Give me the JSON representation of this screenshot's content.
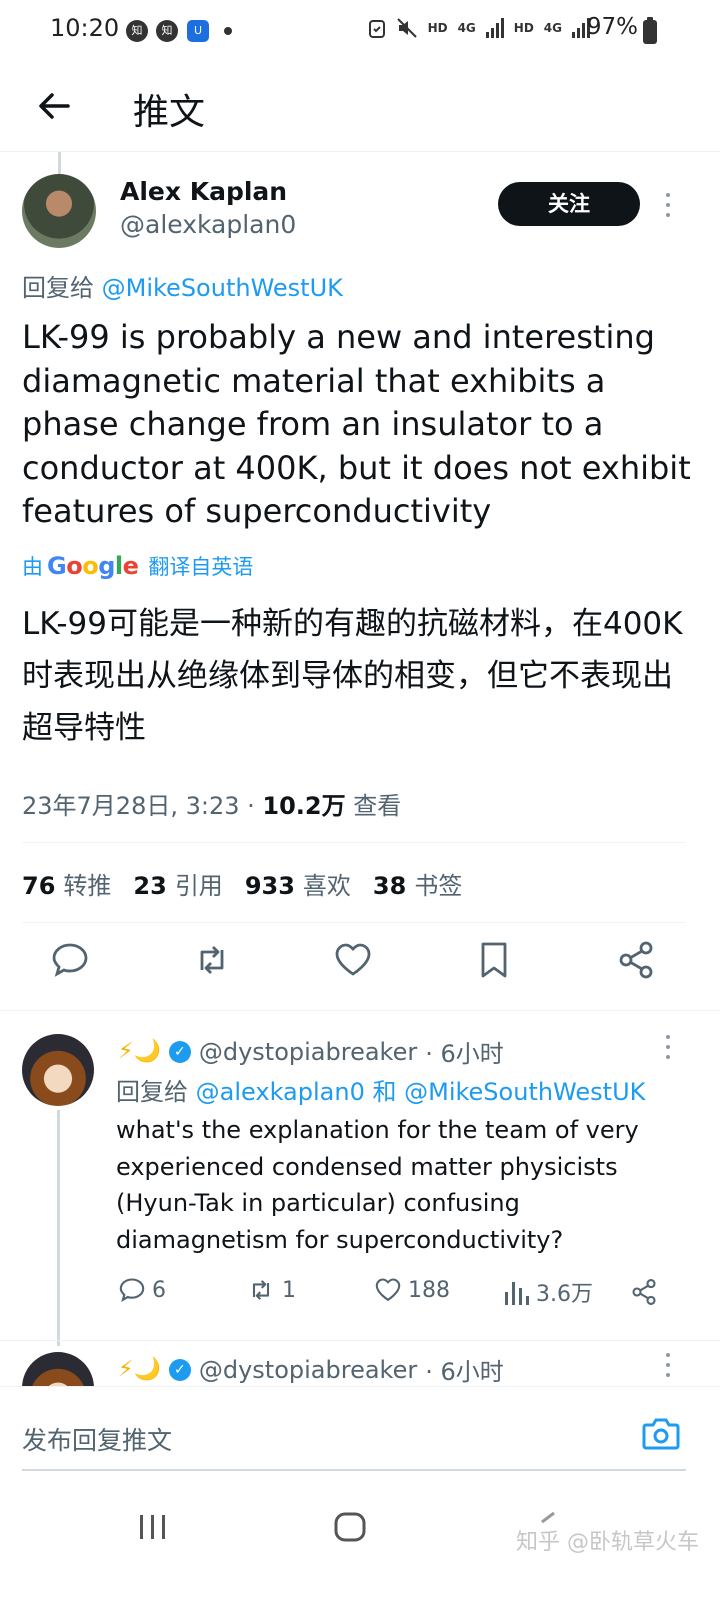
{
  "status_bar": {
    "time": "10:20",
    "badges": [
      "知",
      "知",
      "U"
    ],
    "indicators": [
      "HD",
      "4G",
      "HD",
      "4G"
    ],
    "battery": "97%"
  },
  "header": {
    "title": "推文"
  },
  "tweet": {
    "author_name": "Alex Kaplan",
    "author_handle": "@alexkaplan0",
    "follow_label": "关注",
    "reply_prefix": "回复给",
    "reply_to": "@MikeSouthWestUK",
    "text": "LK-99 is probably a new and interesting diamagnetic material that exhibits a phase change from an insulator to a conductor at 400K, but it does not exhibit features of superconductivity",
    "translate_prefix": "由",
    "translate_brand": "Google",
    "translate_suffix": "翻译自英语",
    "translation": "LK-99可能是一种新的有趣的抗磁材料，在400K时表现出从绝缘体到导体的相变，但它不表现出超导特性",
    "date": "23年7月28日, 3:23 · ",
    "views_count": "10.2万",
    "views_label": " 查看",
    "stats": {
      "retweets": "76",
      "retweets_label": "转推",
      "quotes": "23",
      "quotes_label": "引用",
      "likes": "933",
      "likes_label": "喜欢",
      "bookmarks": "38",
      "bookmarks_label": "书签"
    }
  },
  "replies": [
    {
      "emoji": "⚡🌙",
      "handle": "@dystopiabreaker",
      "time": "· 6小时",
      "reply_prefix": "回复给",
      "reply_to_1": "@alexkaplan0",
      "reply_and": "和",
      "reply_to_2": "@MikeSouthWestUK",
      "text": "what's the explanation for the team of very experienced condensed matter physicists (Hyun-Tak in particular) confusing diamagnetism for superconductivity?",
      "replies": "6",
      "retweets": "1",
      "likes": "188",
      "views": "3.6万"
    },
    {
      "emoji": "⚡🌙",
      "handle": "@dystopiabreaker",
      "time": "· 6小时"
    }
  ],
  "composer": {
    "placeholder": "发布回复推文"
  },
  "watermark": "知乎 @卧轨草火车",
  "colors": {
    "accent": "#1d9bf0",
    "text": "#0f1419",
    "muted": "#536471"
  }
}
